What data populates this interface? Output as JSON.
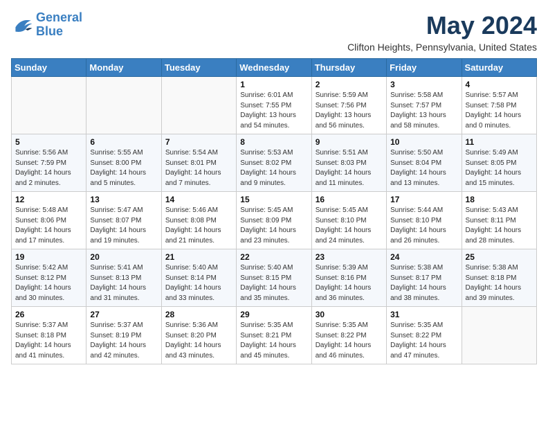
{
  "logo": {
    "line1": "General",
    "line2": "Blue"
  },
  "title": "May 2024",
  "location": "Clifton Heights, Pennsylvania, United States",
  "weekdays": [
    "Sunday",
    "Monday",
    "Tuesday",
    "Wednesday",
    "Thursday",
    "Friday",
    "Saturday"
  ],
  "weeks": [
    [
      {
        "day": "",
        "sunrise": "",
        "sunset": "",
        "daylight": ""
      },
      {
        "day": "",
        "sunrise": "",
        "sunset": "",
        "daylight": ""
      },
      {
        "day": "",
        "sunrise": "",
        "sunset": "",
        "daylight": ""
      },
      {
        "day": "1",
        "sunrise": "Sunrise: 6:01 AM",
        "sunset": "Sunset: 7:55 PM",
        "daylight": "Daylight: 13 hours and 54 minutes."
      },
      {
        "day": "2",
        "sunrise": "Sunrise: 5:59 AM",
        "sunset": "Sunset: 7:56 PM",
        "daylight": "Daylight: 13 hours and 56 minutes."
      },
      {
        "day": "3",
        "sunrise": "Sunrise: 5:58 AM",
        "sunset": "Sunset: 7:57 PM",
        "daylight": "Daylight: 13 hours and 58 minutes."
      },
      {
        "day": "4",
        "sunrise": "Sunrise: 5:57 AM",
        "sunset": "Sunset: 7:58 PM",
        "daylight": "Daylight: 14 hours and 0 minutes."
      }
    ],
    [
      {
        "day": "5",
        "sunrise": "Sunrise: 5:56 AM",
        "sunset": "Sunset: 7:59 PM",
        "daylight": "Daylight: 14 hours and 2 minutes."
      },
      {
        "day": "6",
        "sunrise": "Sunrise: 5:55 AM",
        "sunset": "Sunset: 8:00 PM",
        "daylight": "Daylight: 14 hours and 5 minutes."
      },
      {
        "day": "7",
        "sunrise": "Sunrise: 5:54 AM",
        "sunset": "Sunset: 8:01 PM",
        "daylight": "Daylight: 14 hours and 7 minutes."
      },
      {
        "day": "8",
        "sunrise": "Sunrise: 5:53 AM",
        "sunset": "Sunset: 8:02 PM",
        "daylight": "Daylight: 14 hours and 9 minutes."
      },
      {
        "day": "9",
        "sunrise": "Sunrise: 5:51 AM",
        "sunset": "Sunset: 8:03 PM",
        "daylight": "Daylight: 14 hours and 11 minutes."
      },
      {
        "day": "10",
        "sunrise": "Sunrise: 5:50 AM",
        "sunset": "Sunset: 8:04 PM",
        "daylight": "Daylight: 14 hours and 13 minutes."
      },
      {
        "day": "11",
        "sunrise": "Sunrise: 5:49 AM",
        "sunset": "Sunset: 8:05 PM",
        "daylight": "Daylight: 14 hours and 15 minutes."
      }
    ],
    [
      {
        "day": "12",
        "sunrise": "Sunrise: 5:48 AM",
        "sunset": "Sunset: 8:06 PM",
        "daylight": "Daylight: 14 hours and 17 minutes."
      },
      {
        "day": "13",
        "sunrise": "Sunrise: 5:47 AM",
        "sunset": "Sunset: 8:07 PM",
        "daylight": "Daylight: 14 hours and 19 minutes."
      },
      {
        "day": "14",
        "sunrise": "Sunrise: 5:46 AM",
        "sunset": "Sunset: 8:08 PM",
        "daylight": "Daylight: 14 hours and 21 minutes."
      },
      {
        "day": "15",
        "sunrise": "Sunrise: 5:45 AM",
        "sunset": "Sunset: 8:09 PM",
        "daylight": "Daylight: 14 hours and 23 minutes."
      },
      {
        "day": "16",
        "sunrise": "Sunrise: 5:45 AM",
        "sunset": "Sunset: 8:10 PM",
        "daylight": "Daylight: 14 hours and 24 minutes."
      },
      {
        "day": "17",
        "sunrise": "Sunrise: 5:44 AM",
        "sunset": "Sunset: 8:10 PM",
        "daylight": "Daylight: 14 hours and 26 minutes."
      },
      {
        "day": "18",
        "sunrise": "Sunrise: 5:43 AM",
        "sunset": "Sunset: 8:11 PM",
        "daylight": "Daylight: 14 hours and 28 minutes."
      }
    ],
    [
      {
        "day": "19",
        "sunrise": "Sunrise: 5:42 AM",
        "sunset": "Sunset: 8:12 PM",
        "daylight": "Daylight: 14 hours and 30 minutes."
      },
      {
        "day": "20",
        "sunrise": "Sunrise: 5:41 AM",
        "sunset": "Sunset: 8:13 PM",
        "daylight": "Daylight: 14 hours and 31 minutes."
      },
      {
        "day": "21",
        "sunrise": "Sunrise: 5:40 AM",
        "sunset": "Sunset: 8:14 PM",
        "daylight": "Daylight: 14 hours and 33 minutes."
      },
      {
        "day": "22",
        "sunrise": "Sunrise: 5:40 AM",
        "sunset": "Sunset: 8:15 PM",
        "daylight": "Daylight: 14 hours and 35 minutes."
      },
      {
        "day": "23",
        "sunrise": "Sunrise: 5:39 AM",
        "sunset": "Sunset: 8:16 PM",
        "daylight": "Daylight: 14 hours and 36 minutes."
      },
      {
        "day": "24",
        "sunrise": "Sunrise: 5:38 AM",
        "sunset": "Sunset: 8:17 PM",
        "daylight": "Daylight: 14 hours and 38 minutes."
      },
      {
        "day": "25",
        "sunrise": "Sunrise: 5:38 AM",
        "sunset": "Sunset: 8:18 PM",
        "daylight": "Daylight: 14 hours and 39 minutes."
      }
    ],
    [
      {
        "day": "26",
        "sunrise": "Sunrise: 5:37 AM",
        "sunset": "Sunset: 8:18 PM",
        "daylight": "Daylight: 14 hours and 41 minutes."
      },
      {
        "day": "27",
        "sunrise": "Sunrise: 5:37 AM",
        "sunset": "Sunset: 8:19 PM",
        "daylight": "Daylight: 14 hours and 42 minutes."
      },
      {
        "day": "28",
        "sunrise": "Sunrise: 5:36 AM",
        "sunset": "Sunset: 8:20 PM",
        "daylight": "Daylight: 14 hours and 43 minutes."
      },
      {
        "day": "29",
        "sunrise": "Sunrise: 5:35 AM",
        "sunset": "Sunset: 8:21 PM",
        "daylight": "Daylight: 14 hours and 45 minutes."
      },
      {
        "day": "30",
        "sunrise": "Sunrise: 5:35 AM",
        "sunset": "Sunset: 8:22 PM",
        "daylight": "Daylight: 14 hours and 46 minutes."
      },
      {
        "day": "31",
        "sunrise": "Sunrise: 5:35 AM",
        "sunset": "Sunset: 8:22 PM",
        "daylight": "Daylight: 14 hours and 47 minutes."
      },
      {
        "day": "",
        "sunrise": "",
        "sunset": "",
        "daylight": ""
      }
    ]
  ]
}
